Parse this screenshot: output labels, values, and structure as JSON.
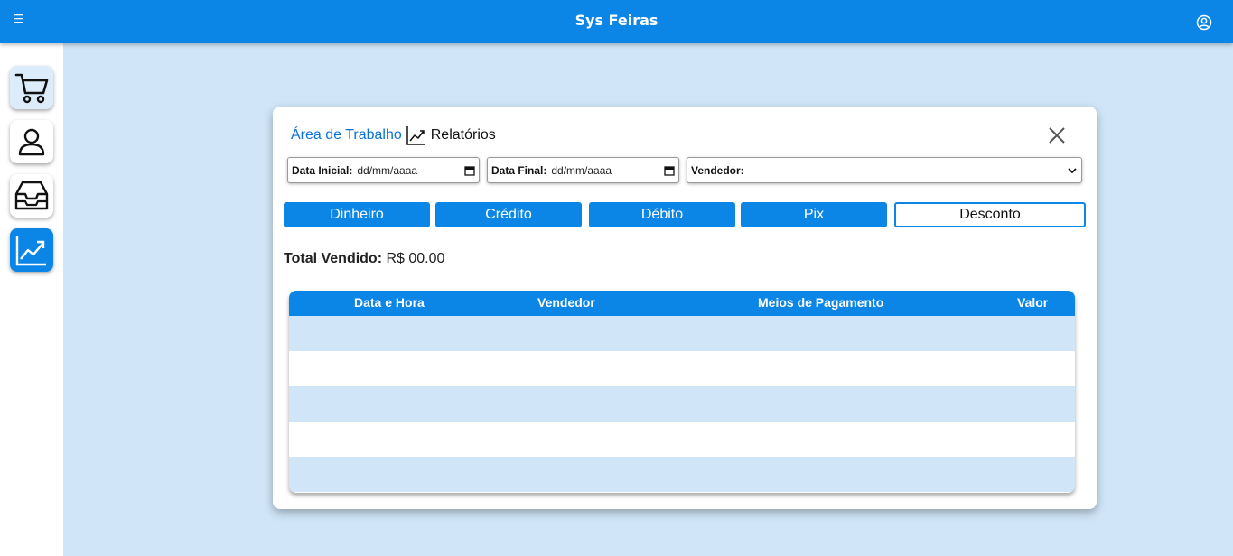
{
  "header": {
    "title": "Sys Feiras",
    "menu_icon": "hamburger-icon",
    "user_icon": "user-circle-icon"
  },
  "sidebar": {
    "items": [
      {
        "icon": "cart-icon",
        "active": false
      },
      {
        "icon": "user-icon",
        "active": false
      },
      {
        "icon": "inbox-icon",
        "active": false
      },
      {
        "icon": "chart-line-icon",
        "active": true
      }
    ]
  },
  "modal": {
    "breadcrumb": {
      "link": "Área de Trabalho",
      "icon": "chart-line-icon",
      "current": "Relatórios"
    },
    "filters": {
      "start_label": "Data Inicial:",
      "start_value": "dd/mm/aaaa",
      "end_label": "Data Final:",
      "end_value": "dd/mm/aaaa",
      "seller_label": "Vendedor:",
      "seller_value": ""
    },
    "payment_buttons": [
      "Dinheiro",
      "Crédito",
      "Débito",
      "Pix",
      "Desconto"
    ],
    "total": {
      "label": "Total Vendido:",
      "value": "R$ 00.00"
    },
    "table": {
      "columns": [
        "Data e Hora",
        "Vendedor",
        "Meios de Pagamento",
        "Valor"
      ],
      "rows": []
    }
  },
  "colors": {
    "primary": "#0b86e6",
    "background": "#d0e5f8",
    "link": "#0b72d6"
  }
}
